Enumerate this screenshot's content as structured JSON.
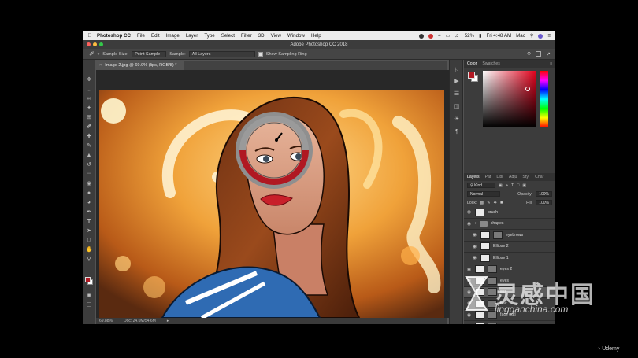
{
  "mac_menubar": {
    "apple_icon": "apple-icon",
    "app_name": "Photoshop CC",
    "menus": [
      "File",
      "Edit",
      "Image",
      "Layer",
      "Type",
      "Select",
      "Filter",
      "3D",
      "View",
      "Window",
      "Help"
    ],
    "battery": "52%",
    "clock": "Fri 4:48 AM",
    "user": "Mac"
  },
  "ps_titlebar": {
    "title": "Adobe Photoshop CC 2018"
  },
  "options_bar": {
    "sample_size_label": "Sample Size:",
    "sample_size_value": "Point Sample",
    "sample_label": "Sample:",
    "sample_value": "All Layers",
    "sampling_ring_label": "Show Sampling Ring"
  },
  "document": {
    "tab_label": "Image 2.jpg @ 69.9% (lips, RGB/8) *"
  },
  "statusbar": {
    "zoom": "69.88%",
    "doc_size": "Doc: 24.0M/54.6M"
  },
  "color_panel": {
    "tabs": [
      "Color",
      "Swatches"
    ],
    "foreground": "#b01822",
    "background": "#ffffff"
  },
  "layers_panel": {
    "tabs": [
      "Layers",
      "Pat",
      "Libr",
      "Adju",
      "Styl",
      "Char"
    ],
    "filter_kind": "Kind",
    "blend_mode": "Normal",
    "opacity_label": "Opacity:",
    "opacity_value": "100%",
    "lock_label": "Lock:",
    "fill_label": "Fill:",
    "fill_value": "100%",
    "layers": [
      {
        "name": "brush",
        "kind": "pixel",
        "selected": false
      },
      {
        "name": "shapes",
        "kind": "group",
        "selected": false
      },
      {
        "name": "eyebrows",
        "kind": "masked",
        "selected": false
      },
      {
        "name": "Ellipse 2",
        "kind": "shape",
        "selected": false
      },
      {
        "name": "Ellipse 1",
        "kind": "shape",
        "selected": false
      },
      {
        "name": "eyes 2",
        "kind": "masked",
        "selected": false
      },
      {
        "name": "eyes",
        "kind": "masked",
        "selected": false
      },
      {
        "name": "lips",
        "kind": "masked",
        "selected": true
      },
      {
        "name": "hair",
        "kind": "masked",
        "selected": false
      },
      {
        "name": "face outl",
        "kind": "masked",
        "selected": false
      },
      {
        "name": "",
        "kind": "masked",
        "selected": false
      },
      {
        "name": "",
        "kind": "pixel",
        "selected": false
      }
    ]
  },
  "watermark": {
    "site_cn": "灵感中国",
    "site_url": "lingganchina.com",
    "udemy": "Udemy"
  },
  "colors": {
    "accent_red": "#b01822",
    "ps_dark": "#3c3c3c",
    "canvas_bg": "#282828"
  }
}
